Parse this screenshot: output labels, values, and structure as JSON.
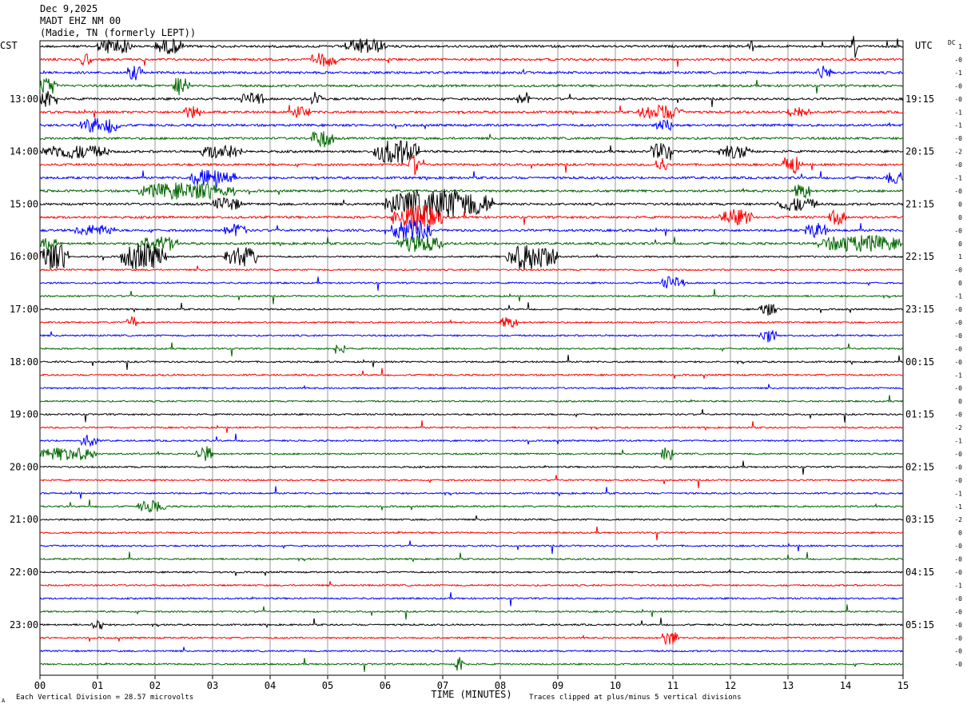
{
  "header": {
    "date": "Dec 9,2025",
    "station": "MADT EHZ NM 00",
    "location": "(Madie, TN (formerly LEPT))"
  },
  "chart_data": {
    "type": "line",
    "subtype": "helicorder",
    "left_axis_title": "CST",
    "right_axis_title": "UTC",
    "dc_label": "DC",
    "x_label": "TIME (MINUTES)",
    "x_ticks": [
      "00",
      "01",
      "02",
      "03",
      "04",
      "05",
      "06",
      "07",
      "08",
      "09",
      "10",
      "11",
      "12",
      "13",
      "14",
      "15"
    ],
    "x_range": [
      0,
      15
    ],
    "cst_labels": [
      "13:00",
      "14:00",
      "15:00",
      "16:00",
      "17:00",
      "18:00",
      "19:00",
      "20:00",
      "21:00",
      "22:00",
      "23:00"
    ],
    "utc_labels": [
      "19:15",
      "20:15",
      "21:15",
      "22:15",
      "23:15",
      "00:15",
      "01:15",
      "02:15",
      "03:15",
      "04:15",
      "05:15"
    ],
    "first_labeled_row": 4,
    "rows_per_hour": 4,
    "trace_count": 48,
    "trace_colors": [
      "#000000",
      "#ff0000",
      "#0000ff",
      "#006600"
    ],
    "dc_offsets": [
      "1",
      "-0",
      "-1",
      "-0",
      "-0",
      "-1",
      "-1",
      "-0",
      "-2",
      "-0",
      "-1",
      "-0",
      "0",
      "0",
      "-0",
      "0",
      "1",
      "-0",
      "0",
      "-1",
      "-0",
      "-0",
      "-0",
      "-0",
      "-0",
      "-1",
      "-0",
      "0",
      "-0",
      "-2",
      "-1",
      "-0",
      "-0",
      "-0",
      "-1",
      "-1",
      "-2",
      "0",
      "-0",
      "-0",
      "-0",
      "-1",
      "-0",
      "-0",
      "-0",
      "-0",
      "-0",
      "-0"
    ],
    "activity": [
      [
        0,
        [
          [
            1.0,
            1.6,
            1.6
          ],
          [
            2.0,
            2.5,
            1.4
          ],
          [
            5.3,
            6.0,
            1.5
          ],
          [
            12.3,
            12.4,
            2.5
          ],
          [
            14.1,
            14.2,
            2.5
          ]
        ]
      ],
      [
        1,
        [
          [
            0.7,
            0.9,
            1.2
          ],
          [
            4.7,
            5.2,
            1.3
          ]
        ]
      ],
      [
        2,
        [
          [
            1.5,
            1.8,
            1.4
          ],
          [
            13.5,
            13.8,
            1.3
          ]
        ]
      ],
      [
        3,
        [
          [
            0.0,
            0.3,
            2.0
          ],
          [
            2.3,
            2.6,
            1.8
          ]
        ]
      ],
      [
        4,
        [
          [
            0.0,
            0.3,
            2.0
          ],
          [
            3.5,
            3.9,
            1.3
          ],
          [
            4.7,
            4.9,
            1.5
          ],
          [
            8.3,
            8.5,
            1.5
          ]
        ]
      ],
      [
        5,
        [
          [
            2.5,
            2.8,
            1.2
          ],
          [
            4.4,
            4.7,
            1.2
          ],
          [
            10.4,
            11.2,
            1.4
          ],
          [
            13.0,
            13.4,
            1.2
          ]
        ]
      ],
      [
        6,
        [
          [
            0.7,
            1.4,
            1.6
          ],
          [
            10.7,
            11.0,
            1.2
          ]
        ]
      ],
      [
        7,
        [
          [
            4.7,
            5.1,
            1.8
          ]
        ]
      ],
      [
        8,
        [
          [
            0.0,
            1.2,
            1.3
          ],
          [
            2.8,
            3.5,
            1.4
          ],
          [
            5.8,
            6.6,
            2.5
          ],
          [
            10.6,
            11.0,
            1.6
          ],
          [
            11.8,
            12.4,
            1.2
          ]
        ]
      ],
      [
        9,
        [
          [
            6.4,
            6.6,
            2.0
          ],
          [
            10.7,
            10.9,
            1.5
          ],
          [
            12.9,
            13.2,
            2.0
          ]
        ]
      ],
      [
        10,
        [
          [
            2.6,
            3.4,
            1.8
          ],
          [
            14.7,
            15.0,
            1.4
          ]
        ]
      ],
      [
        11,
        [
          [
            1.7,
            3.4,
            1.6
          ],
          [
            13.1,
            13.4,
            1.6
          ]
        ]
      ],
      [
        12,
        [
          [
            6.0,
            7.9,
            3.0
          ],
          [
            3.0,
            3.5,
            1.3
          ],
          [
            12.8,
            13.5,
            1.3
          ]
        ]
      ],
      [
        13,
        [
          [
            6.1,
            7.0,
            2.5
          ],
          [
            11.8,
            12.4,
            1.5
          ],
          [
            13.7,
            14.0,
            1.4
          ]
        ]
      ],
      [
        14,
        [
          [
            6.1,
            6.8,
            2.0
          ],
          [
            0.6,
            1.3,
            1.0
          ],
          [
            3.2,
            3.6,
            1.2
          ],
          [
            13.3,
            13.7,
            1.4
          ]
        ]
      ],
      [
        15,
        [
          [
            0.0,
            0.3,
            1.3
          ],
          [
            1.7,
            2.4,
            1.6
          ],
          [
            6.2,
            7.0,
            1.6
          ],
          [
            13.5,
            15.0,
            1.6
          ]
        ]
      ],
      [
        16,
        [
          [
            0.0,
            0.5,
            2.8
          ],
          [
            1.4,
            2.2,
            2.8
          ],
          [
            3.2,
            3.8,
            2.0
          ],
          [
            8.1,
            9.0,
            2.8
          ]
        ]
      ],
      [
        18,
        [
          [
            10.8,
            11.2,
            1.3
          ]
        ]
      ],
      [
        20,
        [
          [
            12.5,
            12.8,
            1.3
          ]
        ]
      ],
      [
        21,
        [
          [
            1.5,
            1.7,
            1.2
          ],
          [
            8.0,
            8.3,
            1.2
          ]
        ]
      ],
      [
        22,
        [
          [
            12.5,
            12.8,
            1.3
          ]
        ]
      ],
      [
        23,
        [
          [
            5.1,
            5.3,
            1.2
          ]
        ]
      ],
      [
        30,
        [
          [
            0.7,
            1.0,
            1.2
          ]
        ]
      ],
      [
        31,
        [
          [
            0.0,
            1.0,
            1.3
          ],
          [
            2.7,
            3.0,
            1.6
          ],
          [
            10.8,
            11.0,
            1.6
          ]
        ]
      ],
      [
        35,
        [
          [
            1.7,
            2.2,
            1.2
          ]
        ]
      ],
      [
        44,
        [
          [
            0.9,
            1.1,
            1.4
          ]
        ]
      ],
      [
        45,
        [
          [
            10.8,
            11.1,
            1.5
          ]
        ]
      ],
      [
        47,
        [
          [
            7.2,
            7.4,
            1.8
          ]
        ]
      ]
    ]
  },
  "footer": {
    "scale_note": "Each Vertical Division =   28.57 microvolts",
    "clip_note": "Traces clipped at plus/minus 5 vertical divisions",
    "corner_mark": "A"
  }
}
